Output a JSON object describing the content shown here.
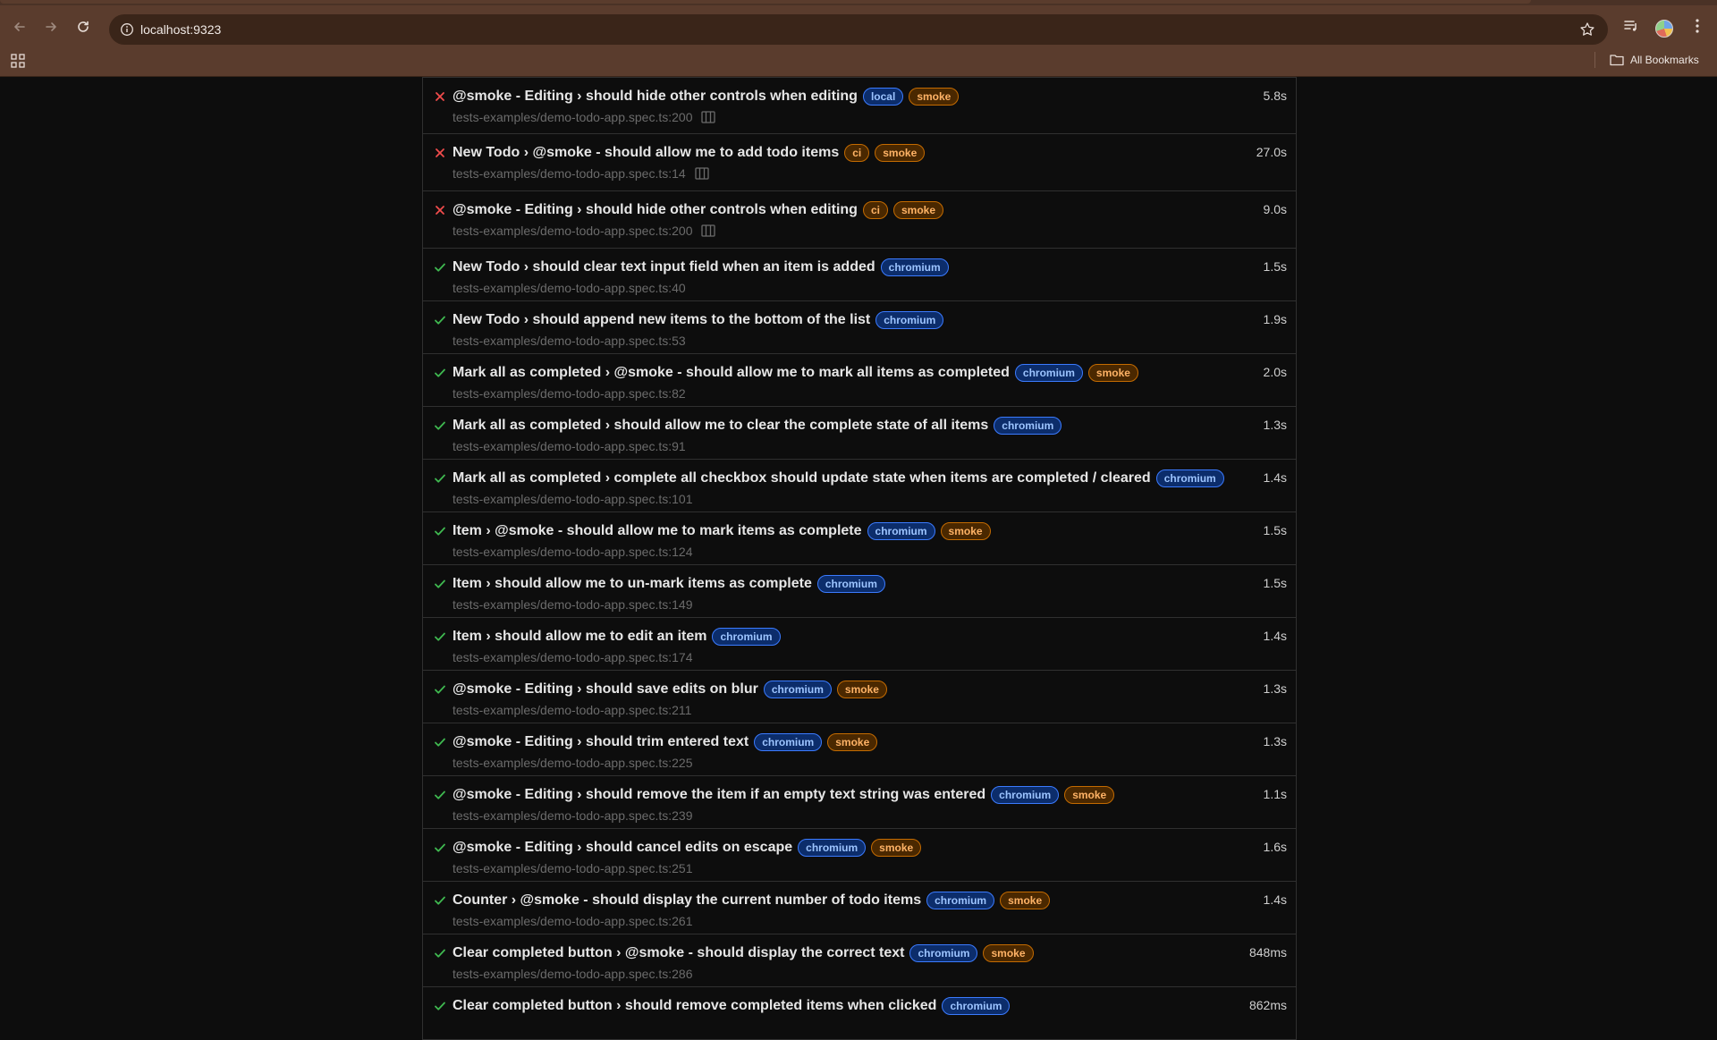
{
  "browser": {
    "url": "localhost:9323",
    "bookmarks_label": "All Bookmarks"
  },
  "tests": [
    {
      "status": "failed",
      "title": "@smoke - Editing › should hide other controls when editing",
      "tags": [
        "local",
        "smoke"
      ],
      "location": "tests-examples/demo-todo-app.spec.ts:200",
      "duration": "5.8s",
      "trace": true
    },
    {
      "status": "failed",
      "title": "New Todo › @smoke - should allow me to add todo items",
      "tags": [
        "ci",
        "smoke"
      ],
      "location": "tests-examples/demo-todo-app.spec.ts:14",
      "duration": "27.0s",
      "trace": true
    },
    {
      "status": "failed",
      "title": "@smoke - Editing › should hide other controls when editing",
      "tags": [
        "ci",
        "smoke"
      ],
      "location": "tests-examples/demo-todo-app.spec.ts:200",
      "duration": "9.0s",
      "trace": true
    },
    {
      "status": "passed",
      "title": "New Todo › should clear text input field when an item is added",
      "tags": [
        "chromium"
      ],
      "location": "tests-examples/demo-todo-app.spec.ts:40",
      "duration": "1.5s"
    },
    {
      "status": "passed",
      "title": "New Todo › should append new items to the bottom of the list",
      "tags": [
        "chromium"
      ],
      "location": "tests-examples/demo-todo-app.spec.ts:53",
      "duration": "1.9s"
    },
    {
      "status": "passed",
      "title": "Mark all as completed › @smoke - should allow me to mark all items as completed",
      "tags": [
        "chromium",
        "smoke"
      ],
      "location": "tests-examples/demo-todo-app.spec.ts:82",
      "duration": "2.0s"
    },
    {
      "status": "passed",
      "title": "Mark all as completed › should allow me to clear the complete state of all items",
      "tags": [
        "chromium"
      ],
      "location": "tests-examples/demo-todo-app.spec.ts:91",
      "duration": "1.3s"
    },
    {
      "status": "passed",
      "title": "Mark all as completed › complete all checkbox should update state when items are completed / cleared",
      "tags": [
        "chromium"
      ],
      "location": "tests-examples/demo-todo-app.spec.ts:101",
      "duration": "1.4s"
    },
    {
      "status": "passed",
      "title": "Item › @smoke - should allow me to mark items as complete",
      "tags": [
        "chromium",
        "smoke"
      ],
      "location": "tests-examples/demo-todo-app.spec.ts:124",
      "duration": "1.5s"
    },
    {
      "status": "passed",
      "title": "Item › should allow me to un-mark items as complete",
      "tags": [
        "chromium"
      ],
      "location": "tests-examples/demo-todo-app.spec.ts:149",
      "duration": "1.5s"
    },
    {
      "status": "passed",
      "title": "Item › should allow me to edit an item",
      "tags": [
        "chromium"
      ],
      "location": "tests-examples/demo-todo-app.spec.ts:174",
      "duration": "1.4s"
    },
    {
      "status": "passed",
      "title": "@smoke - Editing › should save edits on blur",
      "tags": [
        "chromium",
        "smoke"
      ],
      "location": "tests-examples/demo-todo-app.spec.ts:211",
      "duration": "1.3s"
    },
    {
      "status": "passed",
      "title": "@smoke - Editing › should trim entered text",
      "tags": [
        "chromium",
        "smoke"
      ],
      "location": "tests-examples/demo-todo-app.spec.ts:225",
      "duration": "1.3s"
    },
    {
      "status": "passed",
      "title": "@smoke - Editing › should remove the item if an empty text string was entered",
      "tags": [
        "chromium",
        "smoke"
      ],
      "location": "tests-examples/demo-todo-app.spec.ts:239",
      "duration": "1.1s"
    },
    {
      "status": "passed",
      "title": "@smoke - Editing › should cancel edits on escape",
      "tags": [
        "chromium",
        "smoke"
      ],
      "location": "tests-examples/demo-todo-app.spec.ts:251",
      "duration": "1.6s"
    },
    {
      "status": "passed",
      "title": "Counter › @smoke - should display the current number of todo items",
      "tags": [
        "chromium",
        "smoke"
      ],
      "location": "tests-examples/demo-todo-app.spec.ts:261",
      "duration": "1.4s"
    },
    {
      "status": "passed",
      "title": "Clear completed button › @smoke - should display the correct text",
      "tags": [
        "chromium",
        "smoke"
      ],
      "location": "tests-examples/demo-todo-app.spec.ts:286",
      "duration": "848ms"
    },
    {
      "status": "passed",
      "title": "Clear completed button › should remove completed items when clicked",
      "tags": [
        "chromium"
      ],
      "location": "",
      "duration": "862ms"
    }
  ]
}
